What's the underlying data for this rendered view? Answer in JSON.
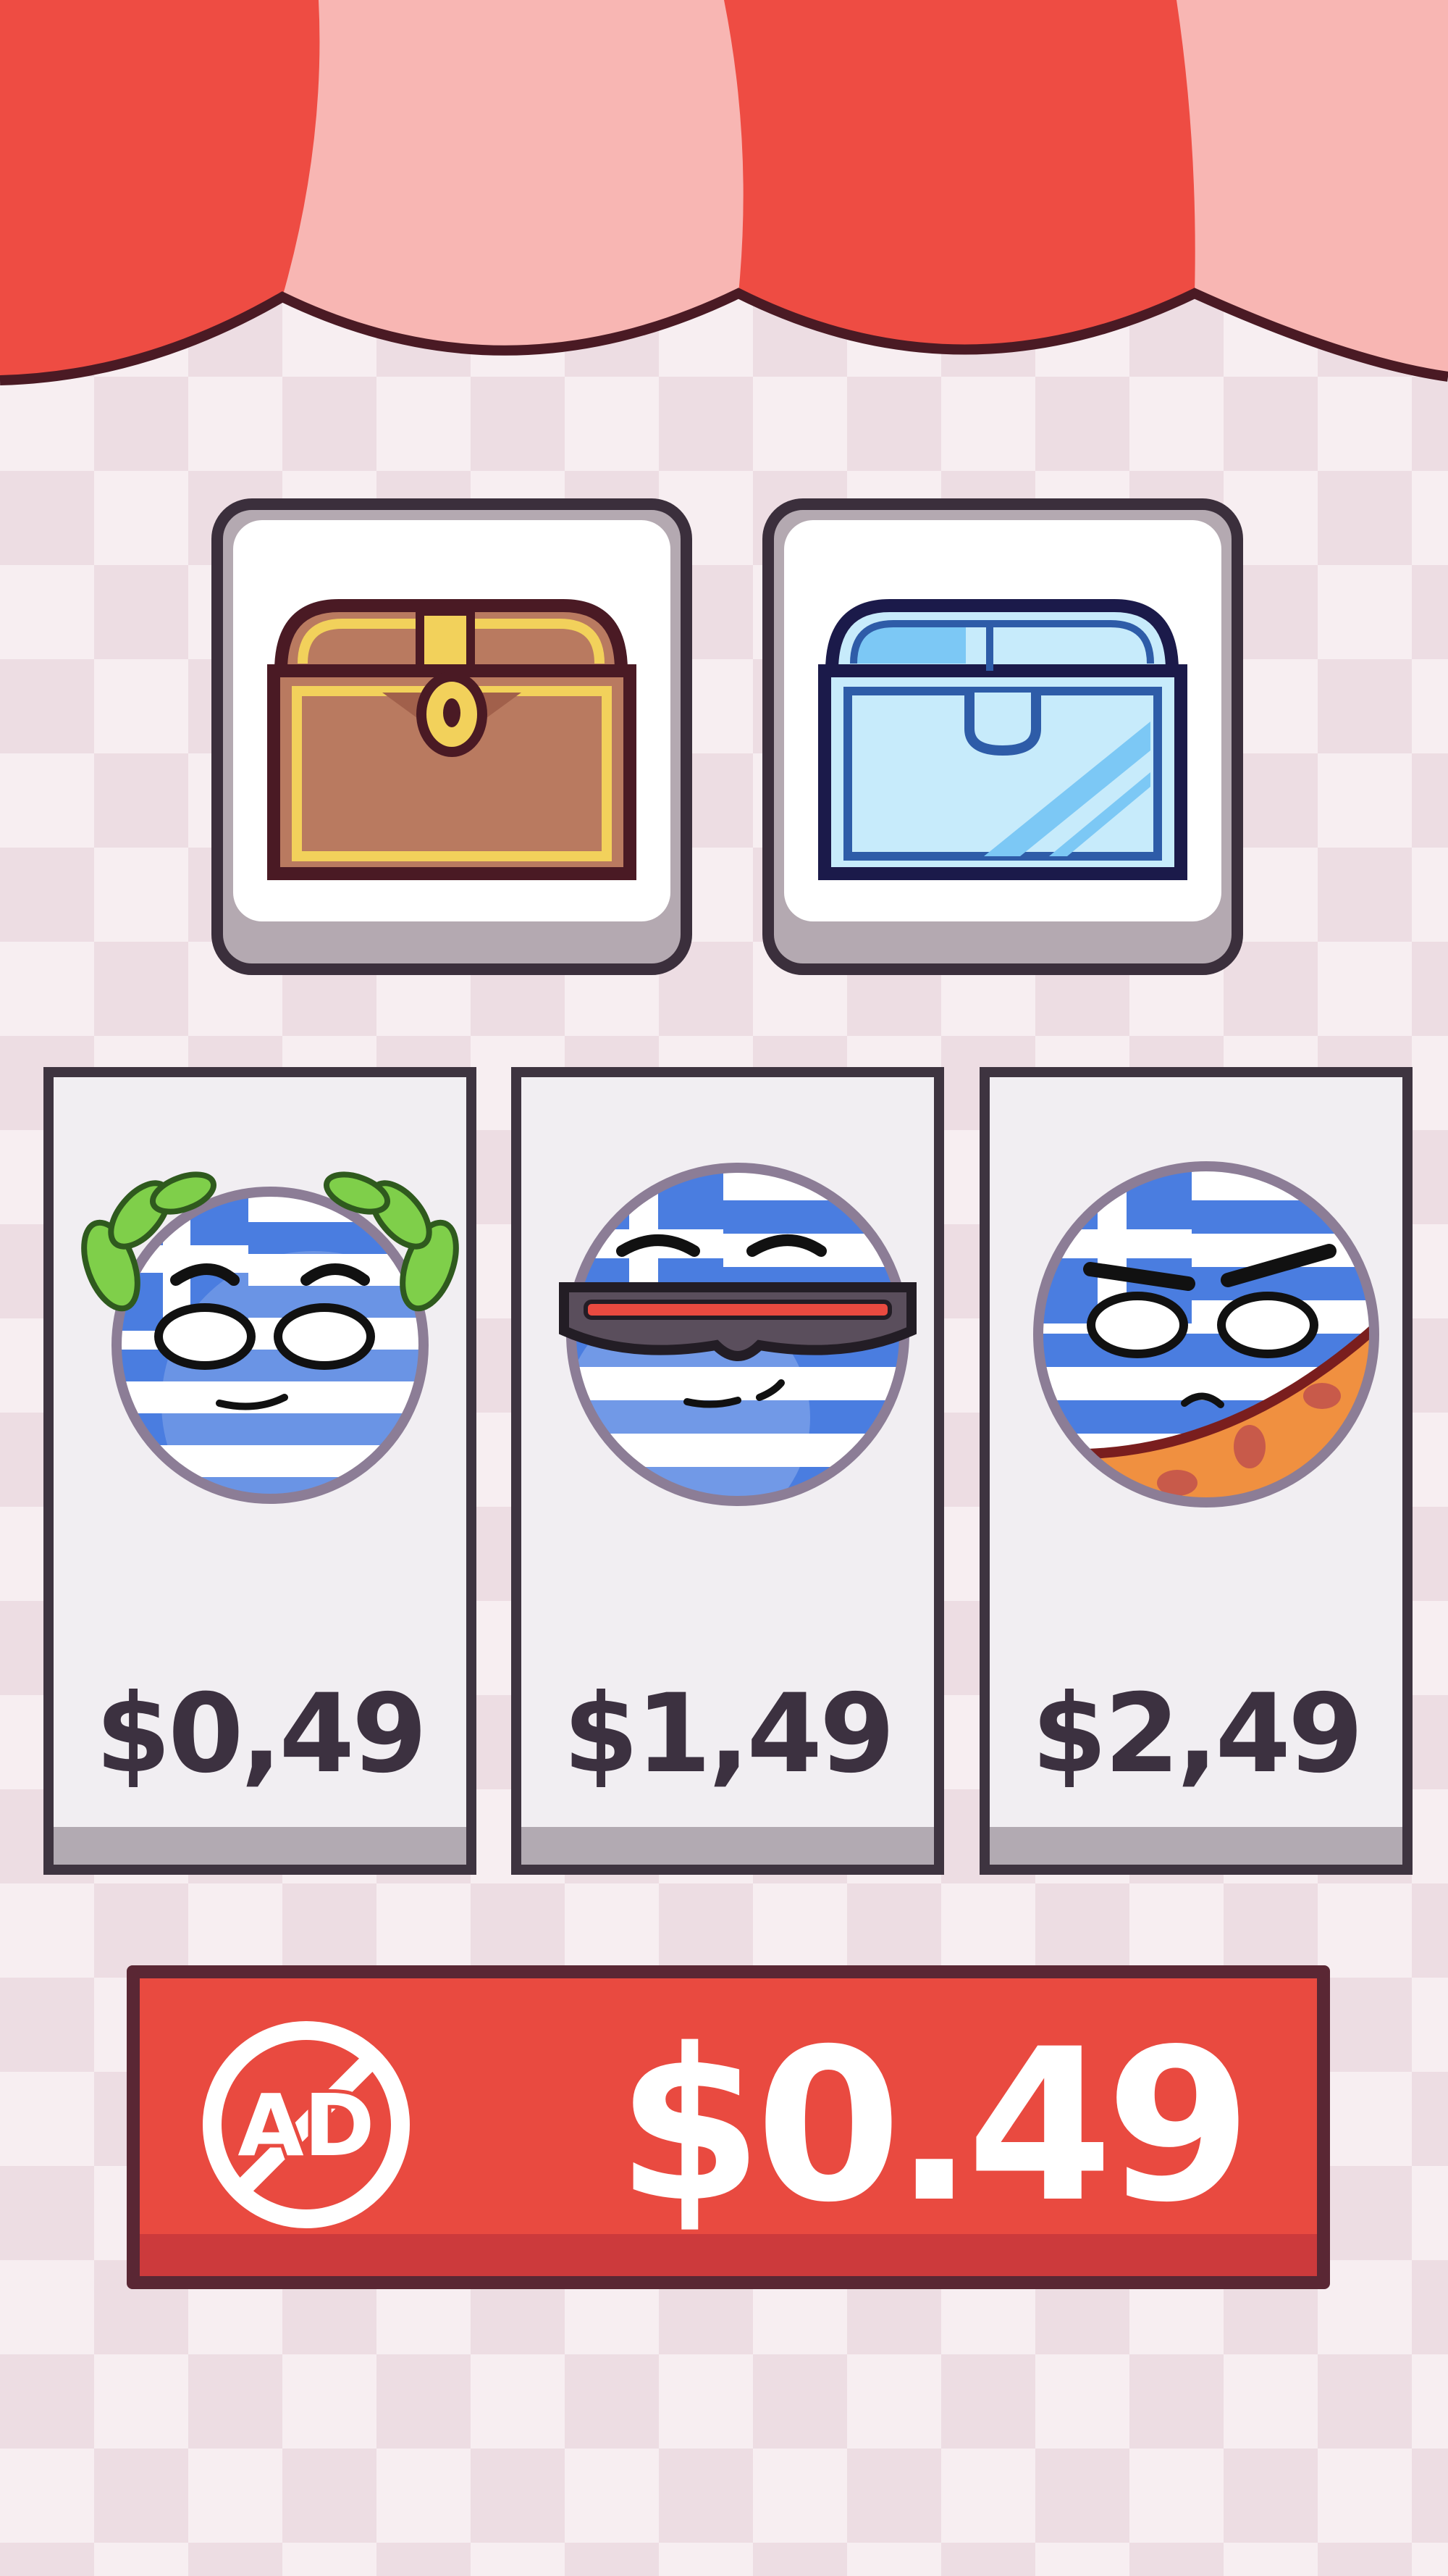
{
  "shop": {
    "chests": [
      {
        "id": "gold-chest",
        "icon": "wooden-chest-icon"
      },
      {
        "id": "glass-chest",
        "icon": "glass-chest-icon"
      }
    ],
    "skins": [
      {
        "price": "$0,49",
        "accessory": "laurel-wreath"
      },
      {
        "price": "$1,49",
        "accessory": "visor-shades"
      },
      {
        "price": "$2,49",
        "accessory": "bandana-mask"
      }
    ],
    "remove_ads": {
      "icon_label": "AD",
      "price": "$0.49"
    }
  },
  "colors": {
    "awning_red": "#ee4c43",
    "awning_pink": "#f8b6b3",
    "outline": "#3e3440",
    "button_red": "#e94a40",
    "flag_blue": "#4a7de0"
  }
}
